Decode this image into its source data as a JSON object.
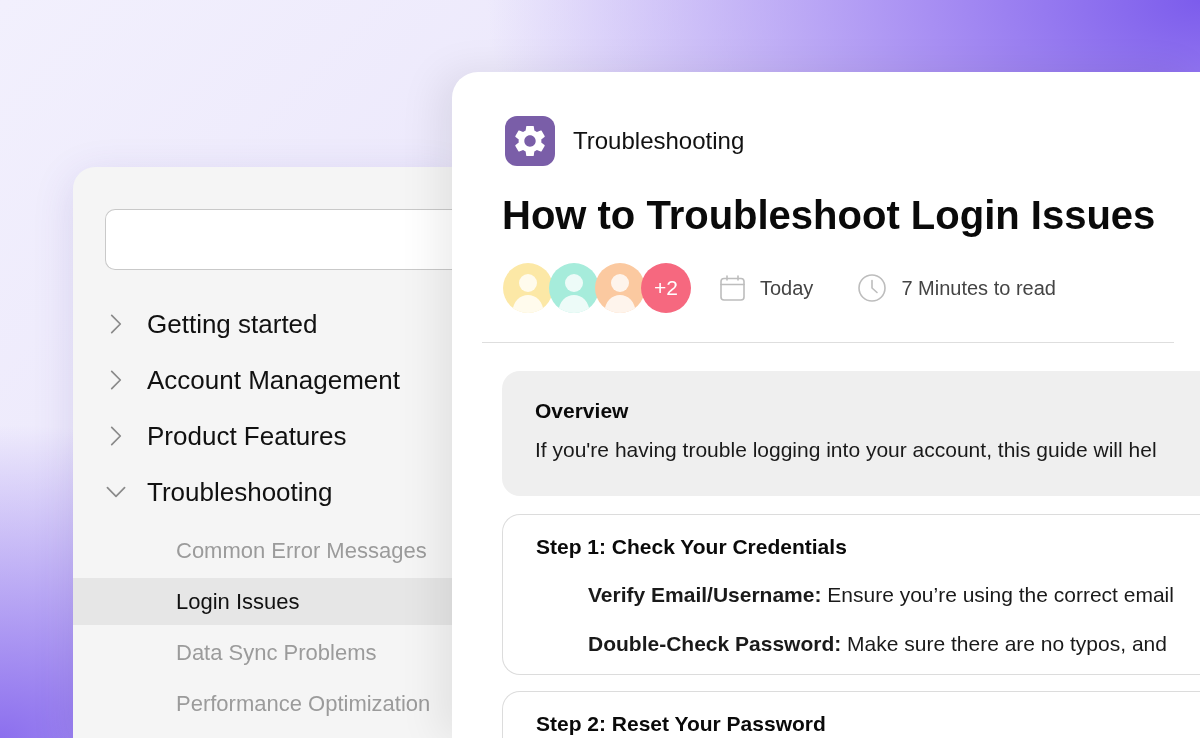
{
  "sidebar": {
    "items": [
      {
        "label": "Getting started",
        "expanded": false,
        "selected": false
      },
      {
        "label": "Account Management",
        "expanded": false,
        "selected": false
      },
      {
        "label": "Product Features",
        "expanded": false,
        "selected": false
      },
      {
        "label": "Troubleshooting",
        "expanded": true,
        "selected": false,
        "children": [
          {
            "label": "Common Error Messages",
            "selected": false
          },
          {
            "label": "Login Issues",
            "selected": true
          },
          {
            "label": "Data Sync Problems",
            "selected": false
          },
          {
            "label": "Performance Optimization",
            "selected": false
          }
        ]
      }
    ]
  },
  "article": {
    "category": "Troubleshooting",
    "title": "How to Troubleshoot Login Issues",
    "authors": [
      {
        "color": "#fce8a6"
      },
      {
        "color": "#a6ecdb"
      },
      {
        "color": "#fbc9a0"
      }
    ],
    "more_authors": "+2",
    "date": "Today",
    "read_time": "7 Minutes to read",
    "overview": {
      "heading": "Overview",
      "text": "If you're having trouble logging into your account, this guide will hel"
    },
    "steps": [
      {
        "title": "Step 1: Check Your Credentials",
        "items": [
          "**Verify Email/Username:** Ensure you’re using the correct email",
          "**Double-Check Password:** Make sure there are no typos, and"
        ]
      },
      {
        "title": "Step 2: Reset Your Password"
      }
    ]
  }
}
